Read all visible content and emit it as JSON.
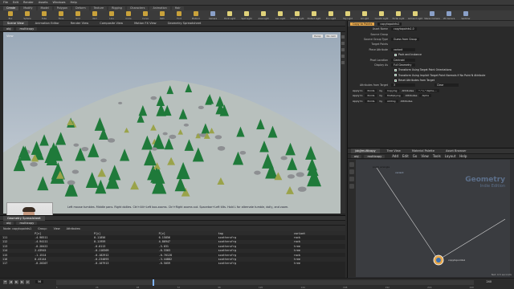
{
  "menubar": [
    "File",
    "Edit",
    "Render",
    "Assets",
    "Windows",
    "Help"
  ],
  "shelf_tabs": [
    {
      "label": "Create",
      "active": true
    },
    {
      "label": "Modify",
      "active": false
    },
    {
      "label": "Model",
      "active": false
    },
    {
      "label": "Polygon",
      "active": false
    },
    {
      "label": "Deform",
      "active": false
    },
    {
      "label": "Texture",
      "active": false
    },
    {
      "label": "Rigging",
      "active": false
    },
    {
      "label": "Characters",
      "active": false
    },
    {
      "label": "Animation",
      "active": false
    },
    {
      "label": "Hair",
      "active": false
    }
  ],
  "shelf_tools": [
    {
      "label": "Box",
      "color": "#c9a23b"
    },
    {
      "label": "Sphere",
      "color": "#c9a23b"
    },
    {
      "label": "Tube",
      "color": "#c9a23b"
    },
    {
      "label": "Torus",
      "color": "#c9a23b"
    },
    {
      "label": "Grid",
      "color": "#c9a23b"
    },
    {
      "label": "Null",
      "color": "#c9a23b"
    },
    {
      "label": "Line",
      "color": "#c9a23b"
    },
    {
      "label": "Circle",
      "color": "#c9a23b"
    },
    {
      "label": "Curve",
      "color": "#c9a23b"
    },
    {
      "label": "Path",
      "color": "#c9a23b"
    },
    {
      "label": "Font",
      "color": "#c9a23b"
    },
    {
      "label": "Platonic",
      "color": "#c9a23b"
    },
    {
      "label": "Camera",
      "color": "#8aa0c8"
    },
    {
      "label": "Point Light",
      "color": "#e0d27a"
    },
    {
      "label": "Spot Light",
      "color": "#e0d27a"
    },
    {
      "label": "Area Light",
      "color": "#e0d27a"
    },
    {
      "label": "Geo Light",
      "color": "#e0d27a"
    },
    {
      "label": "Volume Light",
      "color": "#e0d27a"
    },
    {
      "label": "Distant Light",
      "color": "#e0d27a"
    },
    {
      "label": "Env Light",
      "color": "#e0d27a"
    },
    {
      "label": "Sky Light",
      "color": "#e0d27a"
    },
    {
      "label": "GI Light",
      "color": "#e0d27a"
    },
    {
      "label": "Caustic Light",
      "color": "#e0d27a"
    },
    {
      "label": "Portal Light",
      "color": "#e0d27a"
    },
    {
      "label": "Ambient Light",
      "color": "#e0d27a"
    },
    {
      "label": "Stereo Camera",
      "color": "#8aa0c8"
    },
    {
      "label": "VR Camera",
      "color": "#8aa0c8"
    },
    {
      "label": "Switcher",
      "color": "#8aa0c8"
    }
  ],
  "left_tabs": [
    {
      "label": "Scene View",
      "active": true
    },
    {
      "label": "Animation Editor",
      "active": false
    },
    {
      "label": "Render View",
      "active": false
    },
    {
      "label": "Composite View",
      "active": false
    },
    {
      "label": "Motion FX View",
      "active": false
    },
    {
      "label": "Geometry Spreadsheet",
      "active": false
    }
  ],
  "viewport": {
    "path": "obj",
    "node": "multicopy",
    "label": "View",
    "camera": "Persp",
    "cam_mode": "No cam",
    "status": "Left mouse tumbles. Middle pans. Right dollies. Ctrl+Alt+Left box-zooms. Ctrl+Right zooms out. Spacebar+Left tilts. Hold L for alternate tumble, dolly, and zoom."
  },
  "spreadsheet": {
    "tab": "Geometry Spreadsheet",
    "path": "obj",
    "node": "multicopy",
    "node_label": "Node: copytopoints1",
    "group_label": "Group:",
    "view_label": "View",
    "attrs_label": "Attributes:",
    "columns": [
      "",
      "P[x]",
      "P[y]",
      "P[z]",
      "tag",
      "variant"
    ],
    "rows": [
      [
        "111",
        "-4.98511",
        "0.11856",
        "6.15856",
        "scatterxfrg",
        "rock"
      ],
      [
        "112",
        "-4.94111",
        "0.11959",
        "4.86947",
        "scatterxfrg",
        "rock"
      ],
      [
        "113",
        "-0.28422",
        "-0.0113",
        "-5.031",
        "scatterxfrg",
        "tree"
      ],
      [
        "114",
        "2.43945",
        "-0.118309",
        "-6.3303",
        "scatterxfrg",
        "tree"
      ],
      [
        "115",
        "-1.1514",
        "-0.182912",
        "-0.76128",
        "scatterxfrg",
        "rock"
      ],
      [
        "116",
        "0.43144",
        "-0.234893",
        "-3.44882",
        "scatterxfrg",
        "tree"
      ],
      [
        "117",
        "-0.20207",
        "-0.107913",
        "-6.5059",
        "scatterxfrg",
        "tree"
      ]
    ]
  },
  "timeline": {
    "frame": "56",
    "end": "240",
    "ticks": [
      "1",
      "24",
      "48",
      "72",
      "96",
      "120",
      "144",
      "168",
      "192",
      "216",
      "240"
    ]
  },
  "params": {
    "node_type": "Copy to Points",
    "node_name": "copytopoints1",
    "rows": [
      {
        "label": "Asset Name",
        "value": "copytopoints1.0"
      },
      {
        "label": "Source Group",
        "value": ""
      },
      {
        "label": "Source Group Type",
        "value": "Guess from Group"
      },
      {
        "label": "Target Points",
        "value": ""
      },
      {
        "label": "Piece Attribute",
        "value": "variant"
      }
    ],
    "checks": [
      "Pack and Instance"
    ],
    "rows2": [
      {
        "label": "Pivot Location",
        "value": "Centroid"
      },
      {
        "label": "Display As",
        "value": "Full Geometry"
      }
    ],
    "checks2": [
      "Transform Using Target Point Orientations",
      "Transform Using Implicit Target Point Normals If No Point N Attribute",
      "Reset Attributes from Target"
    ],
    "attr_from_target_label": "Attributes from Target",
    "attr_count": "3",
    "clear_label": "Clear",
    "attr_rows": [
      {
        "apply": "Apply to",
        "target": "Points",
        "op": "Copying",
        "attrs": "*,^v,^Alpha,..."
      },
      {
        "apply": "Apply to",
        "target": "Points",
        "op": "Multiplying",
        "attrs": "Alpha"
      },
      {
        "apply": "Apply to",
        "target": "Points",
        "op": "Adding",
        "attrs": ""
      }
    ],
    "attributes_label": "Attributes"
  },
  "netview": {
    "tabs": [
      "/obj/multicopy",
      "Tree View",
      "Material Palette",
      "Asset Browser"
    ],
    "path": "obj",
    "node": "multicopy",
    "menu": [
      "Add",
      "Edit",
      "Go",
      "View",
      "Tools",
      "Layout",
      "Help"
    ],
    "title": "Geometry",
    "subtitle": "Indie Edition",
    "nodes": [
      {
        "label": "point_wrangle",
        "color": "#bbbbbb"
      },
      {
        "label": "variant",
        "color": "#bbbbbb"
      },
      {
        "label": "copytopoints1",
        "color": "#e5a64a"
      }
    ],
    "status": "Net: 0.5 seconds"
  }
}
